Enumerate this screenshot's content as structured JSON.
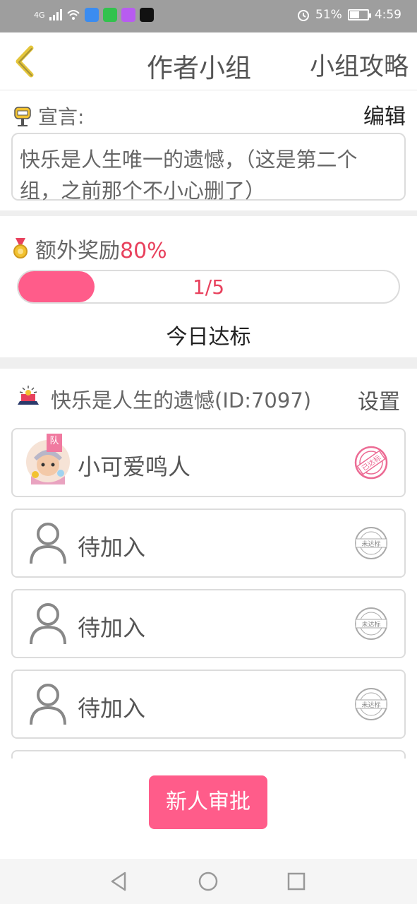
{
  "status_bar": {
    "signal_text": "4G",
    "battery": "51%",
    "battery_level": 0.51,
    "time": "4:59",
    "icons": [
      "signal-icon",
      "wifi-icon",
      "baidu-app-icon",
      "iqiyi-app-icon",
      "video-app-icon",
      "tiktok-app-icon",
      "alarm-icon",
      "battery-icon"
    ]
  },
  "header": {
    "back_icon": "chevron-left-icon",
    "title": "作者小组",
    "guide": "小组攻略"
  },
  "declaration": {
    "label": "宣言:",
    "icon": "mailbox-icon",
    "edit": "编辑",
    "text": "快乐是人生唯一的遗憾，（这是第二个组，之前那个不小心删了）"
  },
  "reward": {
    "label": "额外奖励",
    "percent": "80%",
    "icon": "medal-icon",
    "progress_text": "1/5",
    "progress_fraction": 0.2,
    "today_label": "今日达标"
  },
  "group": {
    "icon": "group-crown-icon",
    "name": "快乐是人生的遗憾(ID:7097)",
    "settings": "设置"
  },
  "members": [
    {
      "name": "小可爱鸣人",
      "leader_badge": "队",
      "stamp": "已达标",
      "status": "done"
    },
    {
      "name": "待加入",
      "stamp": "未达标",
      "status": "pending"
    },
    {
      "name": "待加入",
      "stamp": "未达标",
      "status": "pending"
    },
    {
      "name": "待加入",
      "stamp": "未达标",
      "status": "pending"
    }
  ],
  "approve_button": "新人审批",
  "colors": {
    "accent": "#ff5c8a",
    "accent_text": "#e8415d",
    "back_icon": "#e4c53a",
    "status_bar": "#9e9e9e"
  }
}
